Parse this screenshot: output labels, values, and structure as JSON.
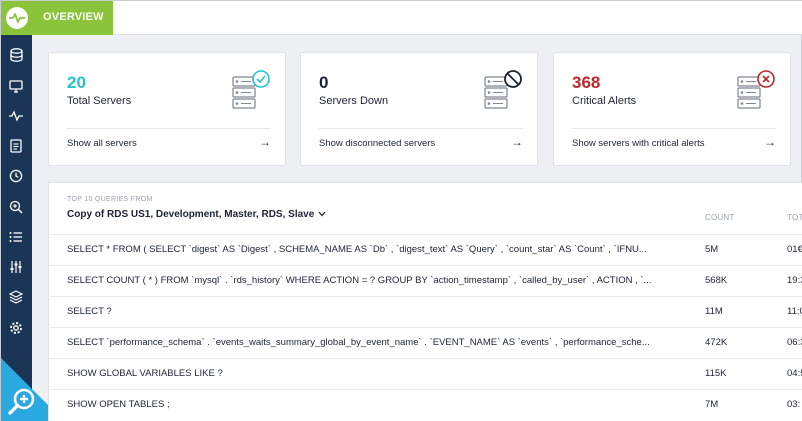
{
  "header": {
    "tab_label": "OVERVIEW"
  },
  "colors": {
    "accent": "#89c43b",
    "sidebar": "#1b3556",
    "teal": "#22c3cf",
    "red": "#c0262b",
    "badge": "#2aa8e0"
  },
  "sidebar": {
    "items": [
      {
        "icon": "database-icon"
      },
      {
        "icon": "monitor-icon"
      },
      {
        "icon": "activity-icon"
      },
      {
        "icon": "document-icon"
      },
      {
        "icon": "clock-icon"
      },
      {
        "icon": "zoom-icon"
      },
      {
        "icon": "list-icon"
      },
      {
        "icon": "sliders-icon"
      },
      {
        "icon": "layers-icon"
      },
      {
        "icon": "gear-icon"
      }
    ]
  },
  "cards": [
    {
      "number": "20",
      "label": "Total Servers",
      "link": "Show all servers",
      "color": "#22c3cf",
      "status_icon": "check-icon"
    },
    {
      "number": "0",
      "label": "Servers Down",
      "link": "Show disconnected servers",
      "color": "#1c2333",
      "status_icon": "blocked-icon"
    },
    {
      "number": "368",
      "label": "Critical Alerts",
      "link": "Show servers with critical alerts",
      "color": "#c0262b",
      "status_icon": "error-icon"
    }
  ],
  "queries": {
    "kicker": "TOP 10 QUERIES FROM",
    "source": "Copy of RDS US1, Development, Master, RDS, Slave",
    "columns": {
      "count": "COUNT",
      "total": "TOT"
    },
    "rows": [
      {
        "query": "SELECT * FROM ( SELECT `digest` AS `Digest` , SCHEMA_NAME AS `Db` , `digest_text` AS `Query` , `count_star` AS `Count` , `IFNU...",
        "count": "5M",
        "total": "01€"
      },
      {
        "query": "SELECT COUNT ( * ) FROM `mysql` . `rds_history` WHERE ACTION = ? GROUP BY `action_timestamp` , `called_by_user` , ACTION , `...",
        "count": "568K",
        "total": "19:3"
      },
      {
        "query": "SELECT ?",
        "count": "11M",
        "total": "11:0"
      },
      {
        "query": "SELECT `performance_schema` . `events_waits_summary_global_by_event_name` . `EVENT_NAME` AS `events` , `performance_sche...",
        "count": "472K",
        "total": "06:3"
      },
      {
        "query": "SHOW GLOBAL VARIABLES LIKE ?",
        "count": "115K",
        "total": "04:5"
      },
      {
        "query": "SHOW OPEN TABLES ;",
        "count": "7M",
        "total": "03:"
      }
    ]
  }
}
